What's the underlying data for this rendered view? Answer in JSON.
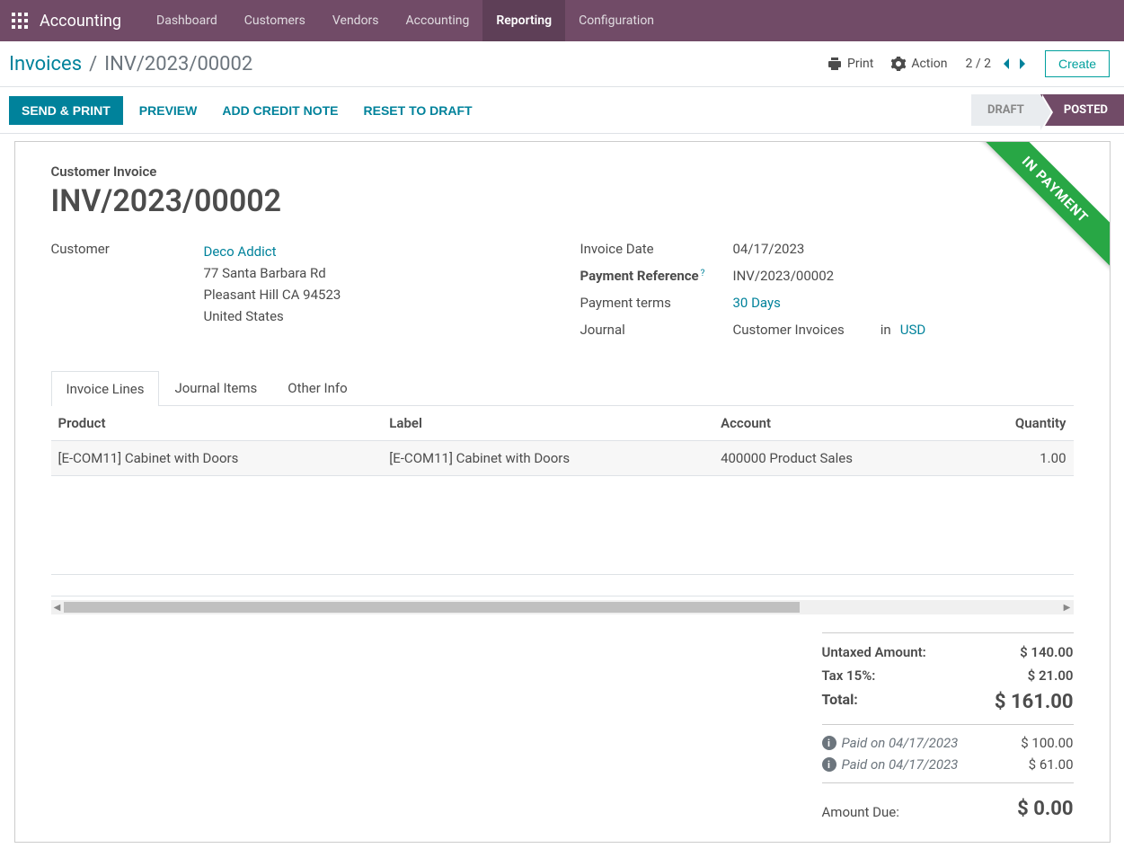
{
  "navbar": {
    "brand": "Accounting",
    "menu": [
      {
        "label": "Dashboard",
        "active": false
      },
      {
        "label": "Customers",
        "active": false
      },
      {
        "label": "Vendors",
        "active": false
      },
      {
        "label": "Accounting",
        "active": false
      },
      {
        "label": "Reporting",
        "active": true
      },
      {
        "label": "Configuration",
        "active": false
      }
    ]
  },
  "breadcrumb": {
    "parent": "Invoices",
    "current": "INV/2023/00002"
  },
  "cp": {
    "print": "Print",
    "action": "Action",
    "pager": "2 / 2",
    "create": "Create"
  },
  "buttons": {
    "send_print": "SEND & PRINT",
    "preview": "PREVIEW",
    "credit_note": "ADD CREDIT NOTE",
    "reset": "RESET TO DRAFT"
  },
  "status": {
    "draft": "DRAFT",
    "posted": "POSTED"
  },
  "ribbon": "IN PAYMENT",
  "title": {
    "subtitle": "Customer Invoice",
    "name": "INV/2023/00002"
  },
  "fields": {
    "customer_label": "Customer",
    "customer_name": "Deco Addict",
    "addr1": "77 Santa Barbara Rd",
    "addr2": "Pleasant Hill CA 94523",
    "addr3": "United States",
    "invoice_date_label": "Invoice Date",
    "invoice_date": "04/17/2023",
    "payment_ref_label": "Payment Reference",
    "payment_ref": "INV/2023/00002",
    "payment_terms_label": "Payment terms",
    "payment_terms": "30 Days",
    "journal_label": "Journal",
    "journal": "Customer Invoices",
    "in": "in",
    "currency": "USD"
  },
  "tabs": {
    "invoice_lines": "Invoice Lines",
    "journal_items": "Journal Items",
    "other_info": "Other Info"
  },
  "table": {
    "headers": {
      "product": "Product",
      "label": "Label",
      "account": "Account",
      "quantity": "Quantity"
    },
    "rows": [
      {
        "product": "[E-COM11] Cabinet with Doors",
        "label": "[E-COM11] Cabinet with Doors",
        "account": "400000 Product Sales",
        "quantity": "1.00"
      }
    ]
  },
  "totals": {
    "untaxed_label": "Untaxed Amount:",
    "untaxed_value": "$ 140.00",
    "tax_label": "Tax 15%:",
    "tax_value": "$ 21.00",
    "total_label": "Total:",
    "total_value": "$ 161.00",
    "payments": [
      {
        "label": "Paid on 04/17/2023",
        "value": "$ 100.00"
      },
      {
        "label": "Paid on 04/17/2023",
        "value": "$ 61.00"
      }
    ],
    "due_label": "Amount Due:",
    "due_value": "$ 0.00"
  }
}
